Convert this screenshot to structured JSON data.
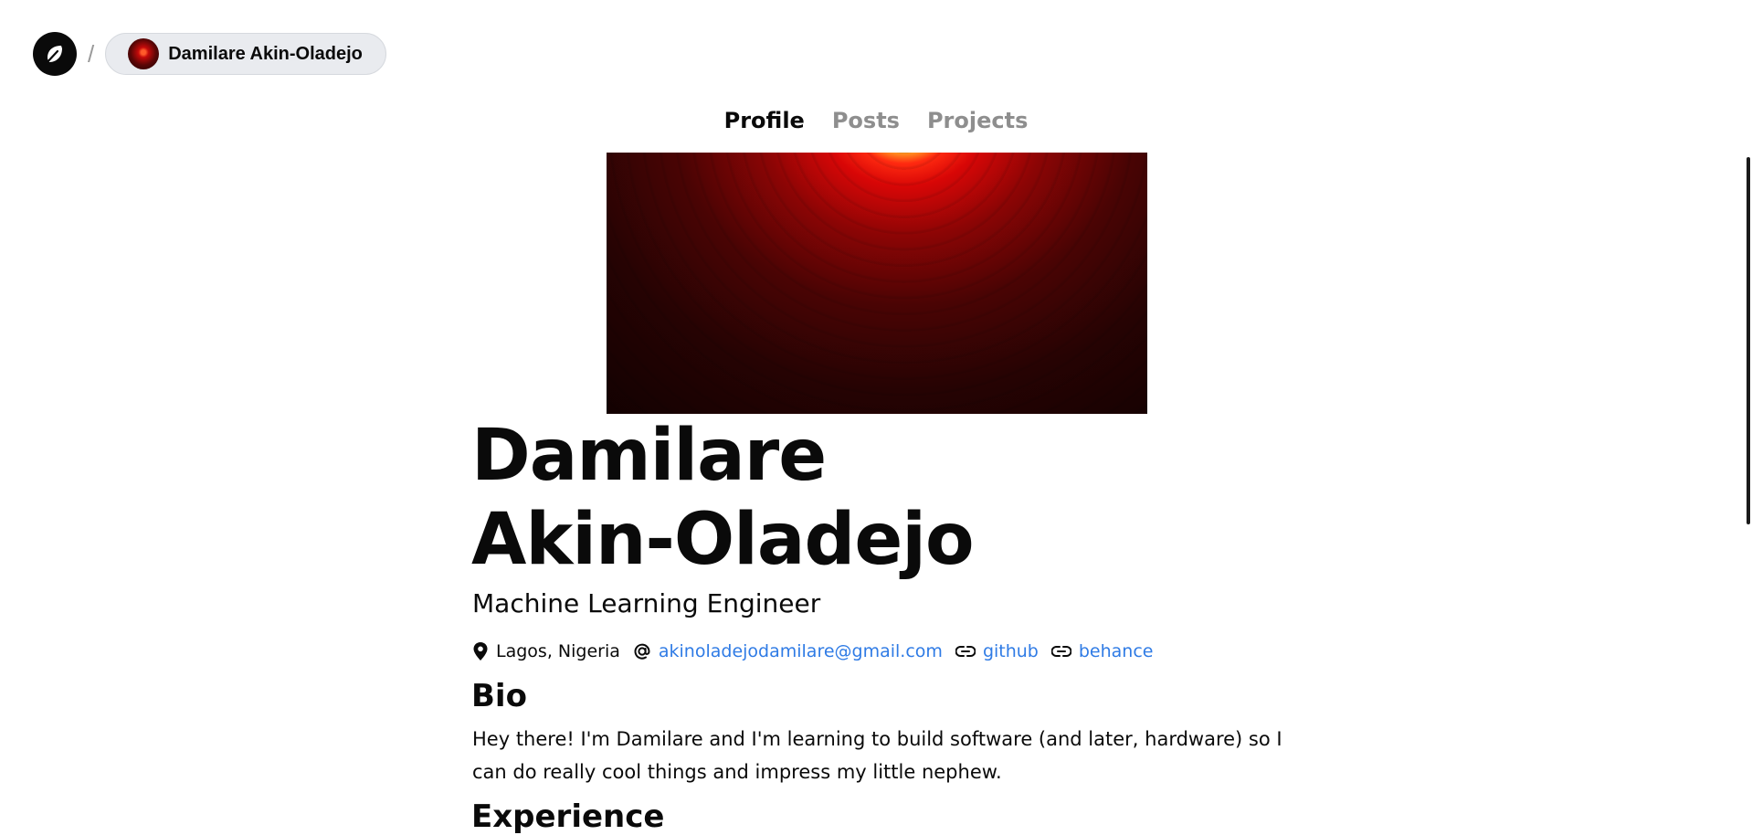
{
  "header": {
    "logo_icon": "leaf-icon",
    "separator": "/",
    "user_name": "Damilare Akin-Oladejo"
  },
  "tabs": [
    {
      "label": "Profile",
      "active": true
    },
    {
      "label": "Posts",
      "active": false
    },
    {
      "label": "Projects",
      "active": false
    }
  ],
  "profile": {
    "name_line1": "Damilare",
    "name_line2": "Akin-Oladejo",
    "role": "Machine Learning Engineer",
    "location": "Lagos, Nigeria",
    "email": "akinoladejodamilare@gmail.com",
    "links": [
      "github",
      "behance"
    ]
  },
  "bio": {
    "heading": "Bio",
    "text": "Hey there! I'm Damilare and I'm learning to build software (and later, hardware) so I can do really cool things and impress my little nephew."
  },
  "experience": {
    "heading": "Experience"
  },
  "colors": {
    "link": "#2f7be5",
    "tab_inactive": "#8e8e8e",
    "pill_bg": "#e9ebef"
  }
}
